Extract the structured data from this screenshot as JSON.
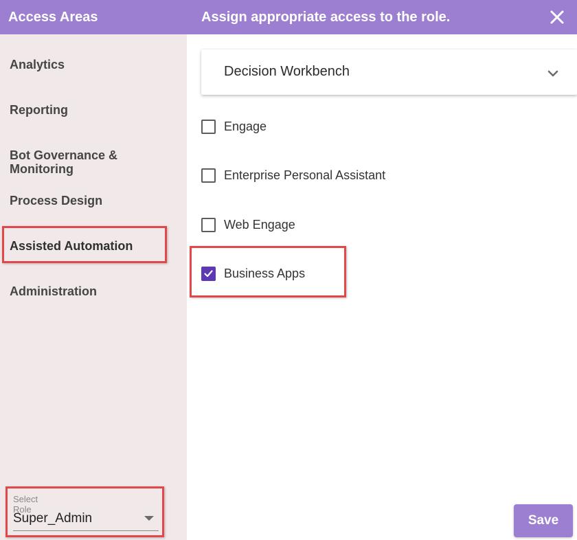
{
  "sidebar": {
    "title": "Access Areas",
    "items": [
      {
        "label": "Analytics"
      },
      {
        "label": "Reporting"
      },
      {
        "label": "Bot Governance & Monitoring"
      },
      {
        "label": "Process Design"
      },
      {
        "label": "Assisted Automation",
        "selected": true
      },
      {
        "label": "Administration"
      }
    ],
    "role": {
      "label": "Select Role",
      "value": "Super_Admin"
    }
  },
  "panel": {
    "title": "Assign appropriate access to the role.",
    "close_icon": "close-icon",
    "dropdown": {
      "label": "Decision Workbench",
      "icon": "chevron-down-icon"
    },
    "options": [
      {
        "label": "Engage",
        "checked": false
      },
      {
        "label": "Enterprise Personal Assistant",
        "checked": false
      },
      {
        "label": "Web Engage",
        "checked": false
      },
      {
        "label": "Business Apps",
        "checked": true
      }
    ],
    "save_label": "Save"
  },
  "colors": {
    "header": "#9c7fd0",
    "sidebar_bg": "#f1e8e9",
    "checkbox_checked": "#5d39b3",
    "highlight": "#e0484a"
  }
}
